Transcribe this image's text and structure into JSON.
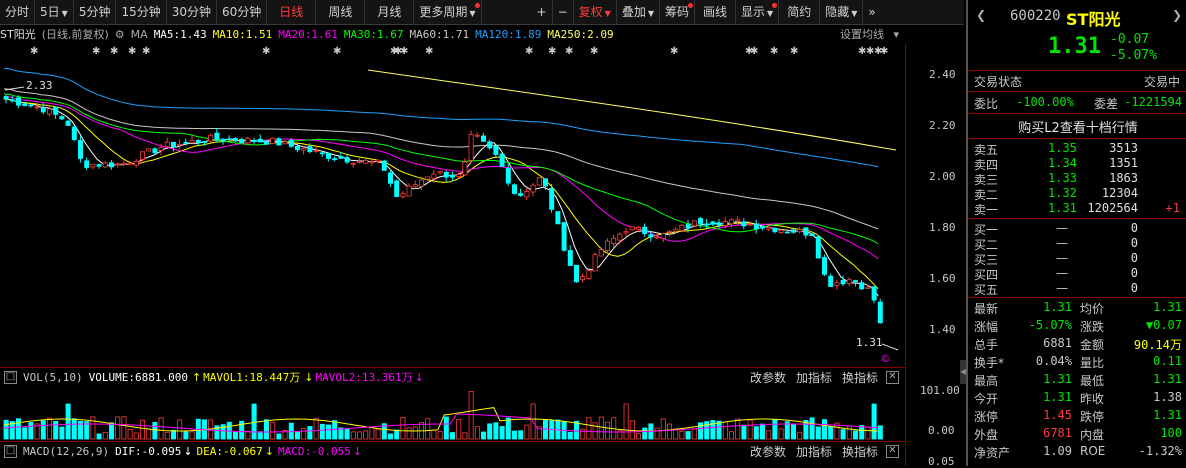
{
  "toolbar": {
    "items": [
      "分时",
      "5日",
      "5分钟",
      "15分钟",
      "30分钟",
      "60分钟",
      "日线",
      "周线",
      "月线",
      "更多周期",
      "+",
      "−",
      "复权",
      "叠加",
      "筹码",
      "画线",
      "显示",
      "简约",
      "隐藏",
      "»"
    ],
    "active": "日线"
  },
  "info": {
    "stock_label": "ST阳光",
    "mode": "(日线,前复权)",
    "ma_label": "MA",
    "ma5": "MA5:1.43",
    "ma10": "MA10:1.51",
    "ma20": "MA20:1.61",
    "ma30": "MA30:1.67",
    "ma60": "MA60:1.71",
    "ma120": "MA120:1.89",
    "ma250": "MA250:2.09",
    "settings": "设置均线"
  },
  "price_axis": [
    "2.40",
    "2.20",
    "2.00",
    "1.80",
    "1.60",
    "1.40"
  ],
  "chart_marks": {
    "high_label": "2.33",
    "last_label": "1.31"
  },
  "volume": {
    "label": "VOL(5,10)",
    "volume": "VOLUME:6881.000",
    "mavol1": "MAVOL1:18.447万",
    "mavol2": "MAVOL2:13.361万",
    "edit": "改参数",
    "add": "加指标",
    "switch": "换指标",
    "axis": [
      "101.00",
      "0.00"
    ]
  },
  "macd": {
    "label": "MACD(12,26,9)",
    "dif": "DIF:-0.095",
    "dea": "DEA:-0.067",
    "macd": "MACD:-0.055",
    "edit": "改参数",
    "add": "加指标",
    "switch": "换指标",
    "axis": "0.05"
  },
  "quote": {
    "code": "600220",
    "name": "ST阳光",
    "price": "1.31",
    "change": "-0.07",
    "change_pct": "-5.07%",
    "status_label": "交易状态",
    "status_value": "交易中",
    "weibi_label": "委比",
    "weibi_value": "-100.00%",
    "weicha_label": "委差",
    "weicha_value": "-1221594",
    "l2_banner": "购买L2查看十档行情",
    "asks": [
      {
        "label": "卖五",
        "price": "1.35",
        "vol": "3513",
        "delta": ""
      },
      {
        "label": "卖四",
        "price": "1.34",
        "vol": "1351",
        "delta": ""
      },
      {
        "label": "卖三",
        "price": "1.33",
        "vol": "1863",
        "delta": ""
      },
      {
        "label": "卖二",
        "price": "1.32",
        "vol": "12304",
        "delta": ""
      },
      {
        "label": "卖一",
        "price": "1.31",
        "vol": "1202564",
        "delta": "+1"
      }
    ],
    "bids": [
      {
        "label": "买一",
        "price": "—",
        "vol": "0"
      },
      {
        "label": "买二",
        "price": "—",
        "vol": "0"
      },
      {
        "label": "买三",
        "price": "—",
        "vol": "0"
      },
      {
        "label": "买四",
        "price": "—",
        "vol": "0"
      },
      {
        "label": "买五",
        "price": "—",
        "vol": "0"
      }
    ],
    "stats": [
      {
        "l1": "最新",
        "v1": "1.31",
        "c1": "down",
        "l2": "均价",
        "v2": "1.31",
        "c2": "down"
      },
      {
        "l1": "涨幅",
        "v1": "-5.07%",
        "c1": "down",
        "l2": "涨跌",
        "v2": "▼0.07",
        "c2": "down"
      },
      {
        "l1": "总手",
        "v1": "6881",
        "c1": "",
        "l2": "金额",
        "v2": "90.14万",
        "c2": "yel"
      },
      {
        "l1": "换手*",
        "v1": "0.04%",
        "c1": "",
        "l2": "量比",
        "v2": "0.11",
        "c2": "down"
      },
      {
        "l1": "最高",
        "v1": "1.31",
        "c1": "down",
        "l2": "最低",
        "v2": "1.31",
        "c2": "down"
      },
      {
        "l1": "今开",
        "v1": "1.31",
        "c1": "down",
        "l2": "昨收",
        "v2": "1.38",
        "c2": ""
      },
      {
        "l1": "涨停",
        "v1": "1.45",
        "c1": "up",
        "l2": "跌停",
        "v2": "1.31",
        "c2": "down"
      },
      {
        "l1": "外盘",
        "v1": "6781",
        "c1": "up",
        "l2": "内盘",
        "v2": "100",
        "c2": "down"
      },
      {
        "l1": "净资产",
        "v1": "1.09",
        "c1": "",
        "l2": "ROE",
        "v2": "-1.32%",
        "c2": ""
      }
    ]
  },
  "colors": {
    "up": "#ff3b3b",
    "down": "#00e600",
    "ma5": "#ffffff",
    "ma10": "#ffff00",
    "ma20": "#ff00ff",
    "ma30": "#00ff00",
    "ma60": "#c8c8c8",
    "ma120": "#1ea0ff",
    "ma250": "#ffff66"
  }
}
